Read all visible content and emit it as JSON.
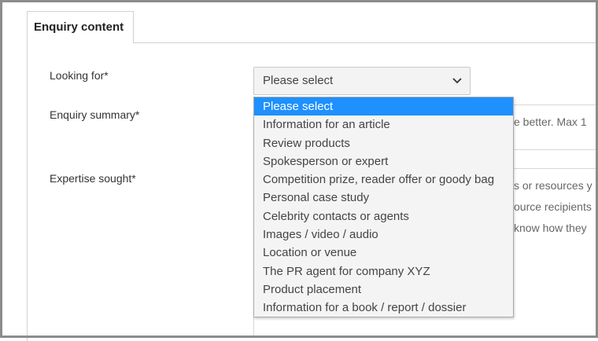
{
  "tab": {
    "label": "Enquiry content"
  },
  "form": {
    "looking_for_label": "Looking for*",
    "enquiry_summary_label": "Enquiry summary*",
    "expertise_sought_label": "Expertise sought*",
    "select_value": "Please select",
    "summary_hint": "e better. Max 1",
    "expertise_hint_lines": [
      "s or resources y",
      "ource recipients",
      "know how they"
    ]
  },
  "dropdown": {
    "options": [
      "Please select",
      "Information for an article",
      "Review products",
      "Spokesperson or expert",
      "Competition prize, reader offer or goody bag",
      "Personal case study",
      "Celebrity contacts or agents",
      "Images / video / audio",
      "Location or venue",
      "The PR agent for company XYZ",
      "Product placement",
      "Information for a book / report / dossier"
    ],
    "selected_index": 0
  },
  "colors": {
    "selected_bg": "#1e90ff",
    "dropdown_bg": "#f4f4f4",
    "frame": "#8c8c8c"
  }
}
